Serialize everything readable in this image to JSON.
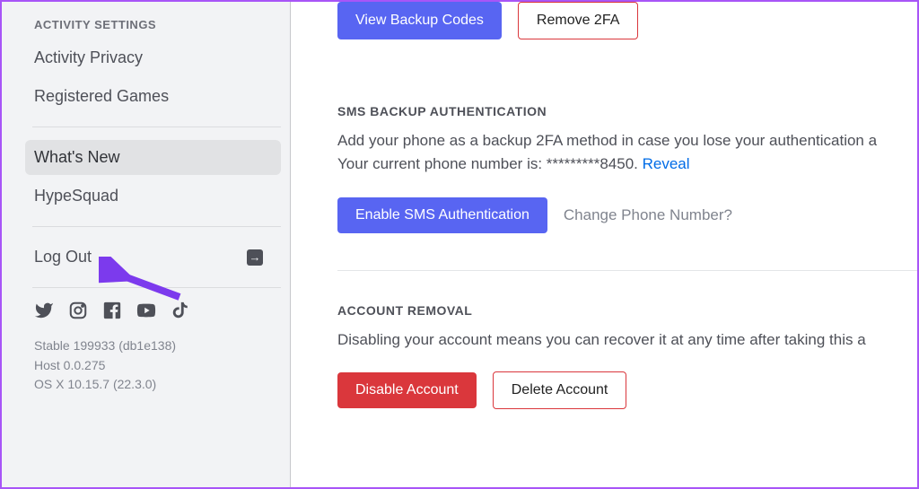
{
  "sidebar": {
    "section_header": "ACTIVITY SETTINGS",
    "items": [
      {
        "label": "Activity Privacy"
      },
      {
        "label": "Registered Games"
      }
    ],
    "secondary_items": [
      {
        "label": "What's New",
        "selected": true
      },
      {
        "label": "HypeSquad"
      }
    ],
    "logout_label": "Log Out",
    "version_line1": "Stable 199933 (db1e138)",
    "version_line2": "Host 0.0.275",
    "version_line3": "OS X 10.15.7 (22.3.0)"
  },
  "main": {
    "backup_codes_btn": "View Backup Codes",
    "remove_2fa_btn": "Remove 2FA",
    "sms_section": {
      "title": "SMS BACKUP AUTHENTICATION",
      "desc_prefix": "Add your phone as a backup 2FA method in case you lose your authentication a",
      "desc_line2_prefix": "Your current phone number is: ",
      "masked_number": "*********8450",
      "reveal_label": "Reveal",
      "period": ". ",
      "enable_btn": "Enable SMS Authentication",
      "change_phone_label": "Change Phone Number?"
    },
    "removal_section": {
      "title": "ACCOUNT REMOVAL",
      "desc": "Disabling your account means you can recover it at any time after taking this a",
      "disable_btn": "Disable Account",
      "delete_btn": "Delete Account"
    }
  }
}
